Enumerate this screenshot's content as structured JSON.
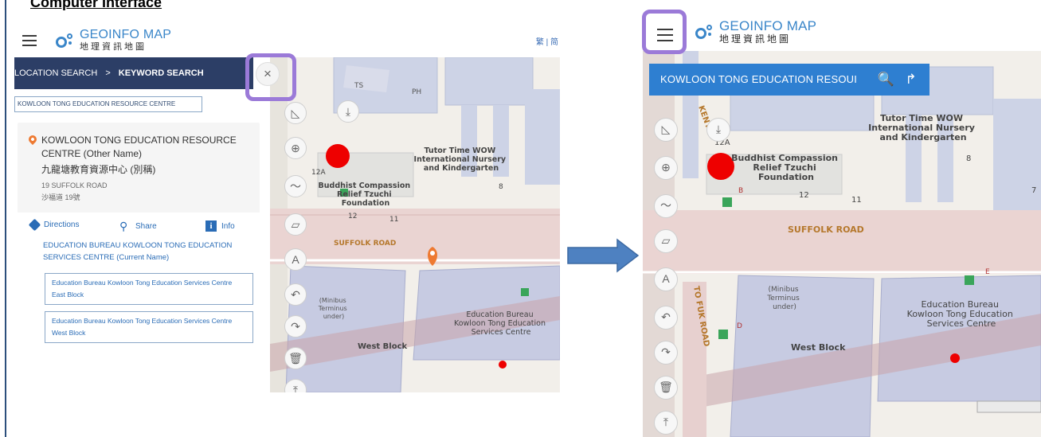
{
  "heading": "Computer Interface",
  "app": {
    "logo_en": "GEOINFO MAP",
    "logo_zh": "地理資訊地圖",
    "lang_switch": "繁 | 简"
  },
  "left": {
    "breadcrumb": [
      "LOCATION SEARCH",
      ">",
      "KEYWORD SEARCH"
    ],
    "close_symbol": "×",
    "search_value": "KOWLOON TONG EDUCATION RESOURCE CENTRE",
    "result": {
      "title": "KOWLOON TONG EDUCATION RESOURCE CENTRE (Other Name)",
      "title_zh": "九龍塘教育資源中心 (別稱)",
      "address_en": "19 SUFFOLK ROAD",
      "address_zh": "沙福道 19號",
      "actions": {
        "directions": "Directions",
        "share": "Share",
        "info": "Info"
      },
      "current_name": "EDUCATION BUREAU KOWLOON TONG EDUCATION SERVICES CENTRE (Current Name)",
      "sub_items": [
        "Education Bureau Kowloon Tong Education Services Centre East Block",
        "Education Bureau Kowloon Tong Education Services Centre West Block"
      ]
    }
  },
  "right": {
    "search_value": "KOWLOON TONG EDUCATION RESOUI",
    "search_icon": "magnifier-icon",
    "directions_icon": "turn-arrow-icon"
  },
  "map": {
    "labels": {
      "ts": "TS",
      "ph": "PH",
      "tutor_time": "Tutor Time WOW International Nursery and Kindergarten",
      "buddhist": "Buddhist Compassion Relief Tzuchi Foundation",
      "suffolk_road": "SUFFOLK ROAD",
      "minibus": "(Minibus Terminus under)",
      "edb": "Education Bureau Kowloon Tong Education Services Centre",
      "west_block": "West Block",
      "to_fuk_road": "TO FUK ROAD",
      "kent": "KENT",
      "n12a": "12A",
      "n12": "12",
      "n11": "11",
      "n8": "8",
      "n7": "7",
      "lb": "B",
      "ld": "D",
      "le": "E"
    }
  },
  "colors": {
    "primary_blue": "#2e7fd1",
    "nav_dark": "#2c3e66",
    "highlight": "#9b7ad8",
    "marker_red": "#ee0000",
    "pin_orange": "#ee7a32"
  }
}
